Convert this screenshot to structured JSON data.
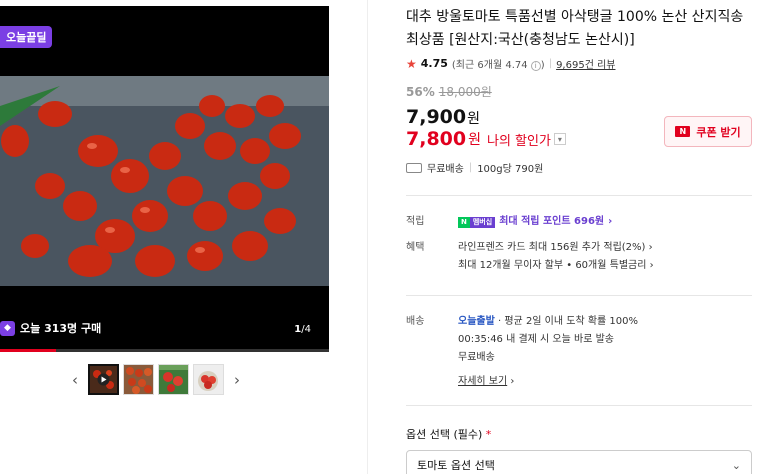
{
  "media": {
    "badge": "오늘끝딜",
    "purchase_text": "오늘 313명 구매",
    "page_current": "1",
    "page_total": "/4",
    "progress": 0.17
  },
  "thumbnails": [
    {
      "name": "thumb-video",
      "play": true
    },
    {
      "name": "thumb-2"
    },
    {
      "name": "thumb-3"
    },
    {
      "name": "thumb-4"
    }
  ],
  "product": {
    "title": "대추 방울토마토 특품선별 아삭탱글 100% 논산 산지직송 최상품 [원산지:국산(충청남도 논산시)]",
    "rating": "4.75",
    "rating_recent": "(최근 6개월 4.74",
    "rating_recent_close": ")",
    "reviews": "9,695건 리뷰",
    "discount_rate": "56%",
    "original_price": "18,000원",
    "price": "7,900",
    "price_unit": "원",
    "my_price": "7,800",
    "my_price_unit": "원",
    "my_price_label": "나의 할인가",
    "coupon_label": "쿠폰 받기",
    "shipping": "무료배송",
    "unit_price": "100g당 790원"
  },
  "benefits": {
    "point_key": "적립",
    "npay_n": "N",
    "npay_m": "멤버십",
    "point_text": "최대 적립 포인트 696원",
    "benefit_key": "혜택",
    "benefit_1": "라인프렌즈 카드 최대 156원 추가 적립(2%)",
    "benefit_2": "최대 12개월 무이자 할부 • 60개월 특별금리"
  },
  "delivery": {
    "key": "배송",
    "today": "오늘출발",
    "arrival": "평균 2일 이내 도착 확률 100%",
    "countdown": "00:35:46  내 결제 시 오늘 바로 발송",
    "free": "무료배송",
    "more": "자세히 보기"
  },
  "option": {
    "label": "옵션 선택 (필수)",
    "required_mark": "*",
    "placeholder": "토마토 옵션 선택"
  },
  "colors": {
    "accent": "#e1001e",
    "purple": "#7b3fe4",
    "npay_green": "#03c75a"
  }
}
